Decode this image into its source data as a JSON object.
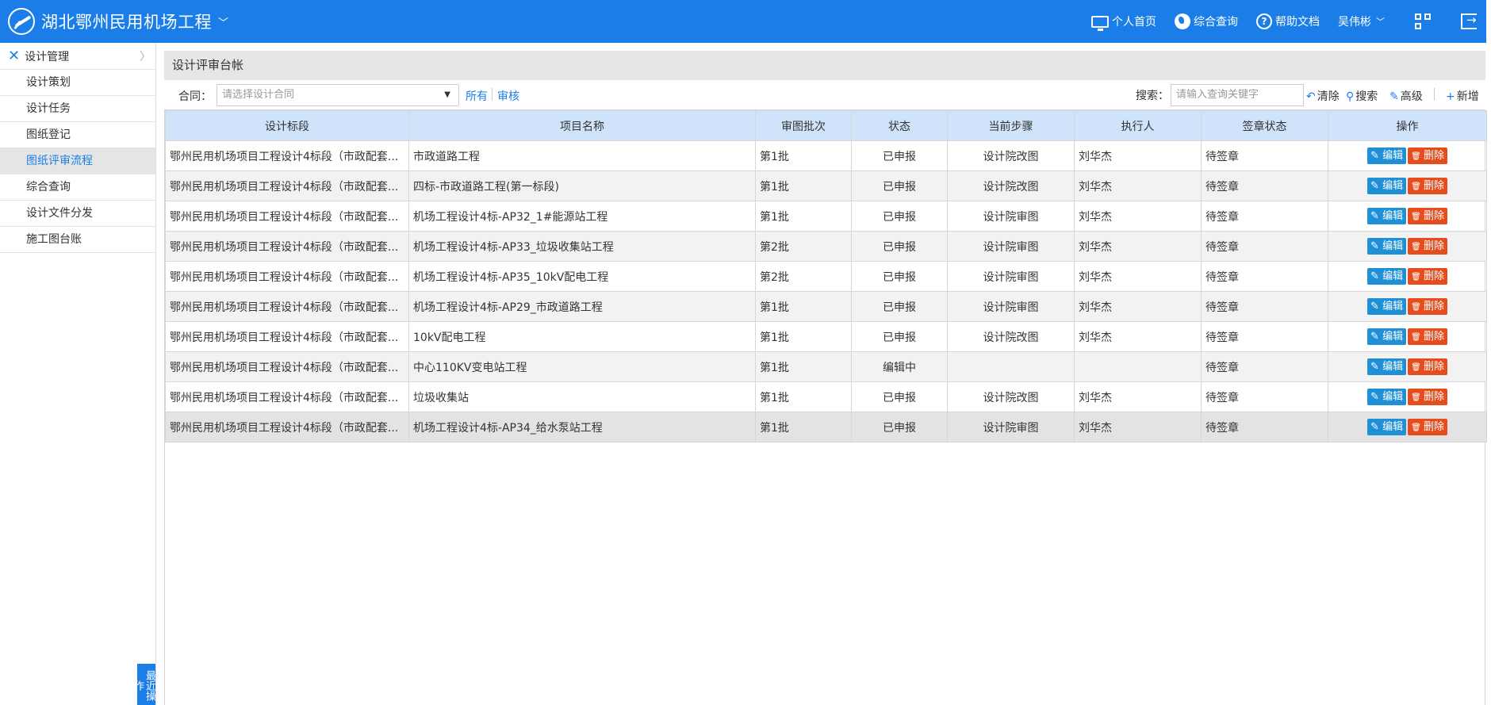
{
  "header": {
    "title": "湖北鄂州民用机场工程",
    "nav": [
      {
        "label": "个人首页",
        "icon": "monitor-icon"
      },
      {
        "label": "综合查询",
        "icon": "globe-icon"
      },
      {
        "label": "帮助文档",
        "icon": "question-icon"
      }
    ],
    "user": "吴伟彬"
  },
  "sidebar": {
    "section": "设计管理",
    "items": [
      {
        "label": "设计策划"
      },
      {
        "label": "设计任务"
      },
      {
        "label": "图纸登记"
      },
      {
        "label": "图纸评审流程"
      },
      {
        "label": "综合查询"
      },
      {
        "label": "设计文件分发"
      },
      {
        "label": "施工图台账"
      }
    ],
    "active_index": 3,
    "recent": "最近操作"
  },
  "panel": {
    "title": "设计评审台帐",
    "filter": {
      "contract_label": "合同：",
      "contract_placeholder": "请选择设计合同",
      "link_all": "所有",
      "link_review": "审核",
      "search_label": "搜索：",
      "search_placeholder": "请输入查询关键字",
      "clear": "清除",
      "search": "搜索",
      "advanced": "高级",
      "add": "新增"
    }
  },
  "table": {
    "columns": [
      "设计标段",
      "项目名称",
      "审图批次",
      "状态",
      "当前步骤",
      "执行人",
      "签章状态",
      "操作"
    ],
    "edit_label": "编辑",
    "delete_label": "删除",
    "rows": [
      [
        "鄂州民用机场项目工程设计4标段（市政配套...",
        "市政道路工程",
        "第1批",
        "已申报",
        "设计院改图",
        "刘华杰",
        "待签章"
      ],
      [
        "鄂州民用机场项目工程设计4标段（市政配套...",
        "四标-市政道路工程(第一标段)",
        "第1批",
        "已申报",
        "设计院改图",
        "刘华杰",
        "待签章"
      ],
      [
        "鄂州民用机场项目工程设计4标段（市政配套...",
        "机场工程设计4标-AP32_1#能源站工程",
        "第1批",
        "已申报",
        "设计院审图",
        "刘华杰",
        "待签章"
      ],
      [
        "鄂州民用机场项目工程设计4标段（市政配套...",
        "机场工程设计4标-AP33_垃圾收集站工程",
        "第2批",
        "已申报",
        "设计院审图",
        "刘华杰",
        "待签章"
      ],
      [
        "鄂州民用机场项目工程设计4标段（市政配套...",
        "机场工程设计4标-AP35_10kV配电工程",
        "第2批",
        "已申报",
        "设计院审图",
        "刘华杰",
        "待签章"
      ],
      [
        "鄂州民用机场项目工程设计4标段（市政配套...",
        "机场工程设计4标-AP29_市政道路工程",
        "第1批",
        "已申报",
        "设计院审图",
        "刘华杰",
        "待签章"
      ],
      [
        "鄂州民用机场项目工程设计4标段（市政配套...",
        "10kV配电工程",
        "第1批",
        "已申报",
        "设计院改图",
        "刘华杰",
        "待签章"
      ],
      [
        "鄂州民用机场项目工程设计4标段（市政配套...",
        "中心110KV变电站工程",
        "第1批",
        "编辑中",
        "",
        "",
        "待签章"
      ],
      [
        "鄂州民用机场项目工程设计4标段（市政配套...",
        "垃圾收集站",
        "第1批",
        "已申报",
        "设计院改图",
        "刘华杰",
        "待签章"
      ],
      [
        "鄂州民用机场项目工程设计4标段（市政配套...",
        "机场工程设计4标-AP34_给水泵站工程",
        "第1批",
        "已申报",
        "设计院审图",
        "刘华杰",
        "待签章"
      ]
    ],
    "selected_row": 9
  }
}
